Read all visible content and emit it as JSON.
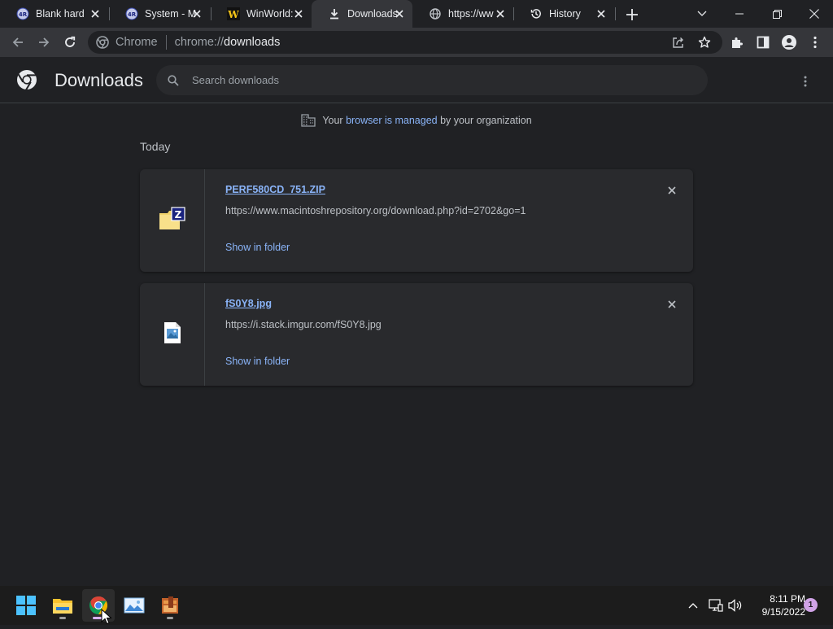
{
  "tabs": [
    {
      "title": "Blank hard",
      "icon": "globe-tech-icon"
    },
    {
      "title": "System - M",
      "icon": "globe-tech-icon"
    },
    {
      "title": "WinWorld:",
      "icon": "winworld-icon"
    },
    {
      "title": "Downloads",
      "icon": "download-icon",
      "active": true
    },
    {
      "title": "https://ww",
      "icon": "globe-icon"
    },
    {
      "title": "History",
      "icon": "history-icon"
    }
  ],
  "omnibox": {
    "site_label": "Chrome",
    "url_prefix": "chrome://",
    "url_path": "downloads"
  },
  "page": {
    "title": "Downloads",
    "search_placeholder": "Search downloads"
  },
  "managed": {
    "prefix": "Your",
    "link": "browser is managed",
    "suffix": "by your organization"
  },
  "day_label": "Today",
  "downloads": [
    {
      "filename": "PERF580CD_751.ZIP",
      "url": "https://www.macintoshrepository.org/download.php?id=2702&go=1",
      "action": "Show in folder",
      "icon": "zip-folder-icon"
    },
    {
      "filename": "fS0Y8.jpg",
      "url": "https://i.stack.imgur.com/fS0Y8.jpg",
      "action": "Show in folder",
      "icon": "image-file-icon"
    }
  ],
  "taskbar": {
    "apps": [
      "windows-start-icon",
      "file-explorer-icon",
      "chrome-icon",
      "photos-icon",
      "archive-app-icon"
    ],
    "time": "8:11 PM",
    "date": "9/15/2022",
    "notification_count": "1"
  },
  "colors": {
    "background": "#202124",
    "toolbar": "#35363a",
    "card": "#292a2d",
    "link": "#8ab4f8",
    "text": "#e8eaed"
  }
}
